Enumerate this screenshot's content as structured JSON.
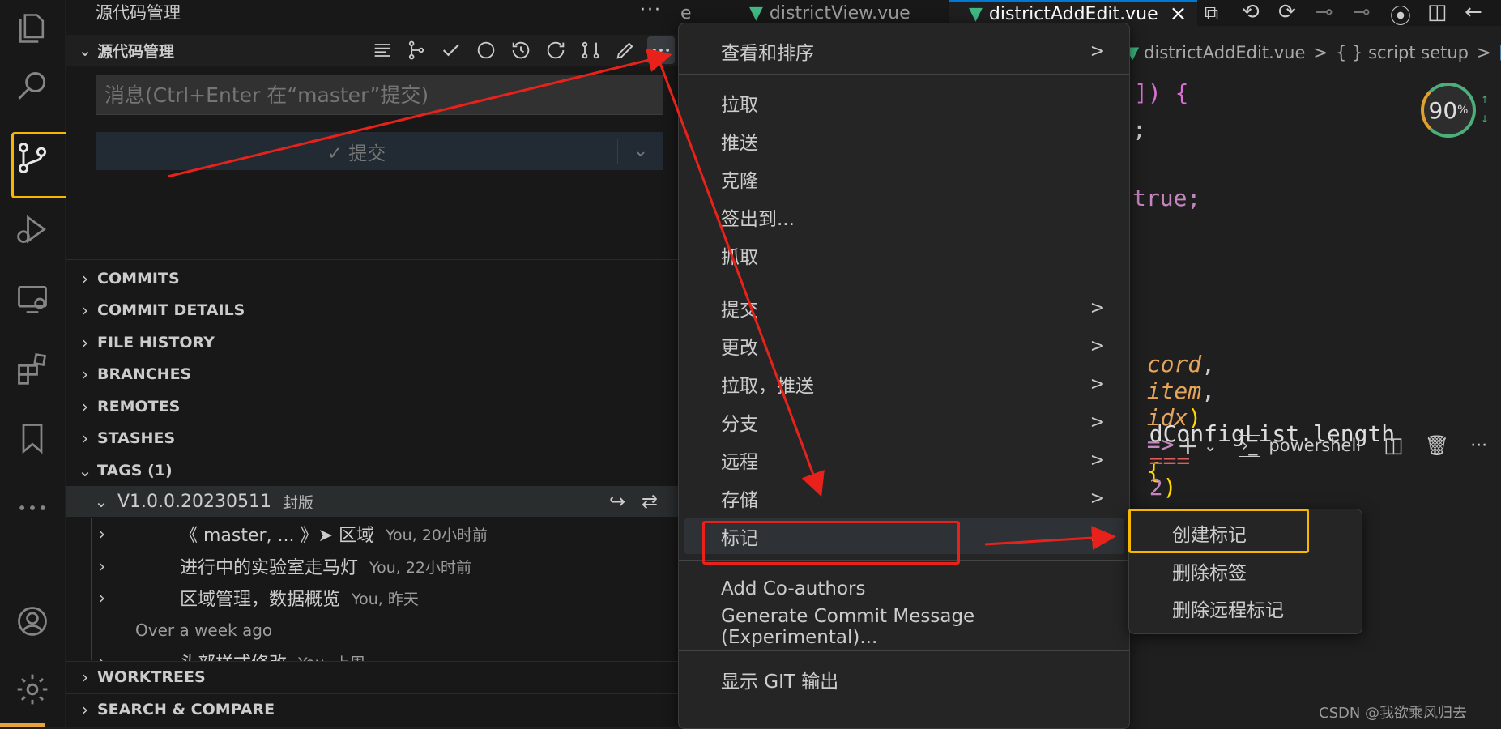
{
  "sidebar": {
    "title": "源代码管理",
    "section_title": "源代码管理",
    "message_placeholder": "消息(Ctrl+Enter 在“master”提交)",
    "commit_button": "✓ 提交",
    "sections": [
      "COMMITS",
      "COMMIT DETAILS",
      "FILE HISTORY",
      "BRANCHES",
      "REMOTES",
      "STASHES"
    ],
    "tags_section": "TAGS (1)",
    "tag": {
      "name": "V1.0.0.20230511",
      "desc": "封版"
    },
    "commits": [
      {
        "label": "《 master, ... 》➤  区域",
        "meta": "You, 20小时前"
      },
      {
        "label": "进行中的实验室走马灯",
        "meta": "You, 22小时前"
      },
      {
        "label": "区域管理，数据概览",
        "meta": "You, 昨天"
      }
    ],
    "group_label": "Over a week ago",
    "partial_commit": {
      "label": "头部样式修改",
      "meta": "You, 上周"
    },
    "bottom_sections": [
      "WORKTREES",
      "SEARCH & COMPARE"
    ]
  },
  "tabs": [
    {
      "label": "e"
    },
    {
      "label": "districtView.vue"
    },
    {
      "label": "districtAddEdit.vue",
      "close": "×"
    }
  ],
  "breadcrumb": {
    "file": "districtAddEdit.vue",
    "sep": ">",
    "symbol": "{ } script setup",
    "sep2": ">"
  },
  "progress_badge": {
    "value": "90",
    "unit": "%"
  },
  "code": {
    "line1": "]) {",
    "line2": ";",
    "line3": "true;",
    "line4_ident1": "cord",
    "line4_comma1": ",",
    "line4_ident2": "item",
    "line4_comma2": ",",
    "line4_ident3": "idx",
    "line4_paren": ")",
    "line4_arrow": "=>",
    "line4_brace": "{",
    "line5_text": "dConfigList.length",
    "line5_op": "===",
    "line5_num": "2",
    "line5_paren": ")"
  },
  "terminal": {
    "add": "+",
    "dropdown": "⌄",
    "shell": "powershell",
    "more": "···",
    "up": "^"
  },
  "menu": {
    "items": [
      {
        "label": "查看和排序",
        "arrow": ">"
      },
      {
        "label": "拉取"
      },
      {
        "label": "推送"
      },
      {
        "label": "克隆"
      },
      {
        "label": "签出到..."
      },
      {
        "label": "抓取"
      },
      {
        "label": "提交",
        "arrow": ">"
      },
      {
        "label": "更改",
        "arrow": ">"
      },
      {
        "label": "拉取，推送",
        "arrow": ">"
      },
      {
        "label": "分支",
        "arrow": ">"
      },
      {
        "label": "远程",
        "arrow": ">"
      },
      {
        "label": "存储",
        "arrow": ">"
      },
      {
        "label": "标记",
        "arrow": ">"
      },
      {
        "label": "Add Co-authors"
      },
      {
        "label": "Generate Commit Message (Experimental)..."
      },
      {
        "label": "显示 GIT 输出"
      }
    ]
  },
  "submenu": {
    "items": [
      "创建标记",
      "删除标签",
      "删除远程标记"
    ]
  },
  "watermark": "CSDN @我欲乘风归去",
  "colors": {
    "highlight_box": "#f5b700",
    "annotation_red": "#e8221b",
    "accent_blue": "#0078d4"
  }
}
